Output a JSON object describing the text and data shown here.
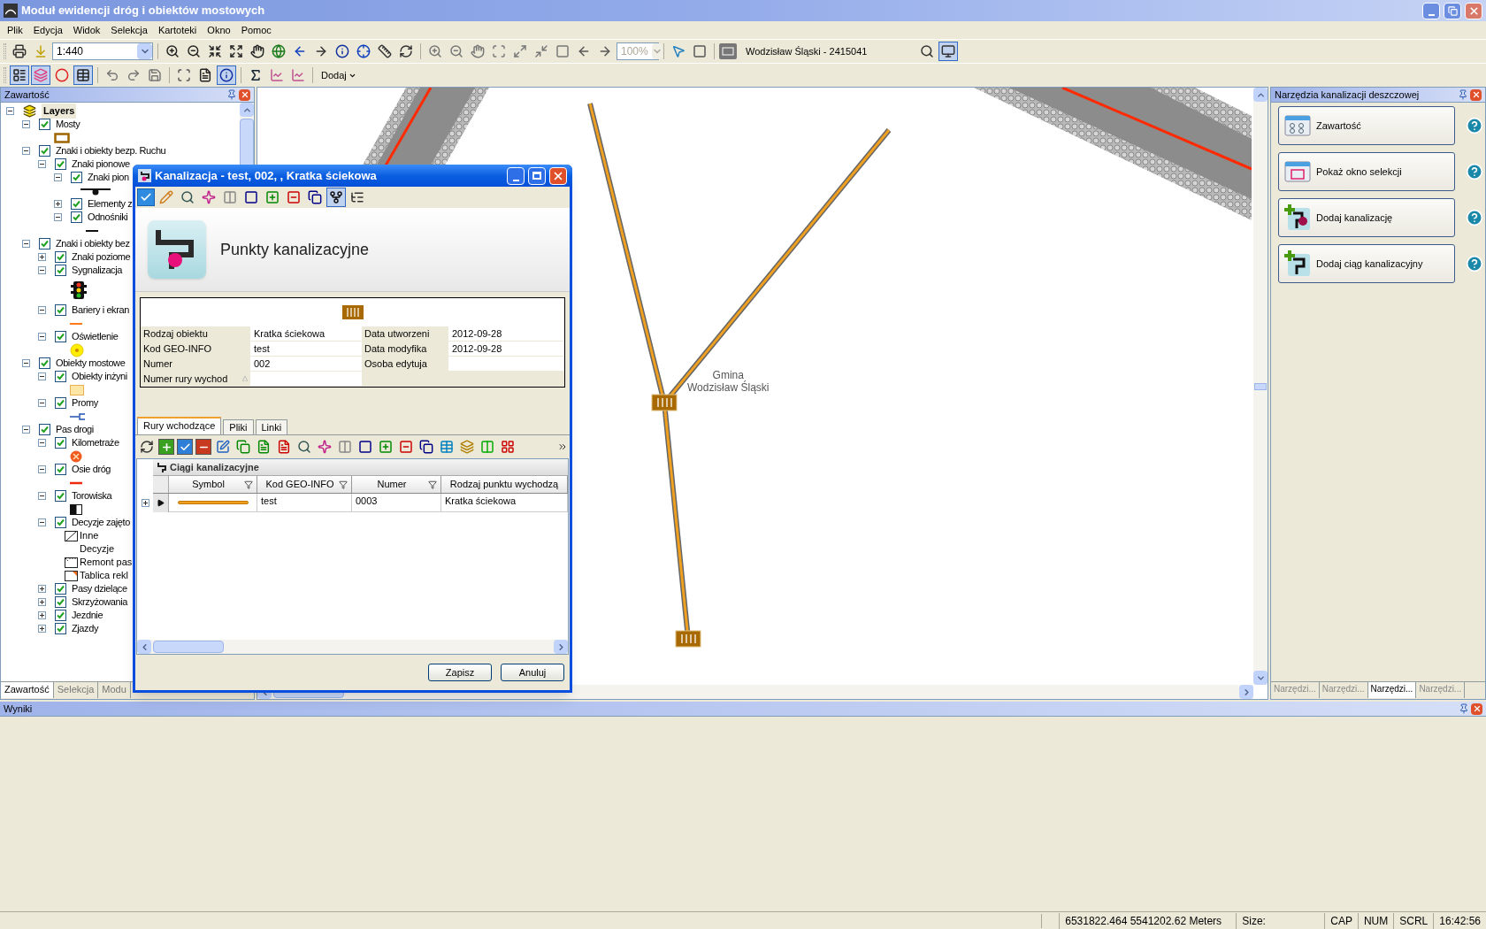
{
  "window": {
    "title": "Moduł ewidencji dróg i obiektów mostowych"
  },
  "menu": [
    "Plik",
    "Edycja",
    "Widok",
    "Selekcja",
    "Kartoteki",
    "Okno",
    "Pomoc"
  ],
  "toolbar": {
    "scale": "1:440",
    "zoom_percent": "100%",
    "location": "Wodzisław Śląski - 2415041",
    "add_button": "Dodaj"
  },
  "left_panel": {
    "title": "Zawartość",
    "tree": [
      {
        "label": "Layers",
        "kind": "root",
        "expanded": true,
        "children": [
          {
            "label": "Mosty",
            "kind": "layer",
            "checked": true,
            "expanded": true,
            "legend": {
              "kind": "frame"
            }
          },
          {
            "label": "Znaki i obiekty bezp. Ruchu",
            "kind": "layer",
            "checked": true,
            "expanded": true,
            "children": [
              {
                "label": "Znaki pionowe",
                "kind": "layer",
                "checked": true,
                "expanded": true,
                "children": [
                  {
                    "label": "Znaki pion",
                    "kind": "layer",
                    "checked": true,
                    "expanded": true,
                    "legend": {
                      "kind": "sign"
                    }
                  },
                  {
                    "label": "Elementy z",
                    "kind": "layer",
                    "checked": true,
                    "expanded": false
                  },
                  {
                    "label": "Odnośniki",
                    "kind": "layer",
                    "checked": true,
                    "expanded": true,
                    "legend": {
                      "kind": "dash"
                    }
                  }
                ]
              }
            ]
          },
          {
            "label": "Znaki i obiekty bez",
            "kind": "layer",
            "checked": true,
            "expanded": true,
            "children": [
              {
                "label": "Znaki poziome",
                "kind": "layer",
                "checked": true,
                "expanded": false
              },
              {
                "label": "Sygnalizacja",
                "kind": "layer",
                "checked": true,
                "expanded": true,
                "legend": {
                  "kind": "signal"
                }
              },
              {
                "label": "Bariery i ekran",
                "kind": "layer",
                "checked": true,
                "expanded": true,
                "legend": {
                  "kind": "barrier"
                }
              },
              {
                "label": "Oświetlenie",
                "kind": "layer",
                "checked": true,
                "expanded": true,
                "legend": {
                  "kind": "lamp"
                }
              }
            ]
          },
          {
            "label": "Obiekty mostowe",
            "kind": "layer",
            "checked": true,
            "expanded": true,
            "children": [
              {
                "label": "Obiekty inżyni",
                "kind": "layer",
                "checked": true,
                "expanded": true,
                "legend": {
                  "kind": "area"
                }
              },
              {
                "label": "Promy",
                "kind": "layer",
                "checked": true,
                "expanded": true,
                "legend": {
                  "kind": "ferry"
                }
              }
            ]
          },
          {
            "label": "Pas drogi",
            "kind": "layer",
            "checked": true,
            "expanded": true,
            "children": [
              {
                "label": "Kilometraże",
                "kind": "layer",
                "checked": true,
                "expanded": true,
                "legend": {
                  "kind": "milestone"
                }
              },
              {
                "label": "Osie dróg",
                "kind": "layer",
                "checked": true,
                "expanded": true,
                "legend": {
                  "kind": "axis"
                }
              },
              {
                "label": "Torowiska",
                "kind": "layer",
                "checked": true,
                "expanded": true,
                "legend": {
                  "kind": "track"
                }
              },
              {
                "label": "Decyzje zajęto",
                "kind": "layer",
                "checked": true,
                "expanded": true,
                "legend_items": [
                  {
                    "label": "Inne",
                    "kind": "hatch"
                  },
                  {
                    "label": "Decyzje",
                    "kind": "none"
                  },
                  {
                    "label": "Remont pas",
                    "kind": "corner"
                  },
                  {
                    "label": "Tablica rekl",
                    "kind": "flag"
                  }
                ]
              },
              {
                "label": "Pasy dzielące",
                "kind": "layer",
                "checked": true,
                "expanded": false
              },
              {
                "label": "Skrzyżowania",
                "kind": "layer",
                "checked": true,
                "expanded": false
              },
              {
                "label": "Jezdnie",
                "kind": "layer",
                "checked": true,
                "expanded": false
              },
              {
                "label": "Zjazdy",
                "kind": "layer",
                "checked": true,
                "expanded": false
              }
            ]
          }
        ]
      }
    ],
    "tabs": [
      {
        "label": "Zawartość",
        "selected": true
      },
      {
        "label": "Selekcja",
        "selected": false
      },
      {
        "label": "Modu",
        "selected": false
      }
    ]
  },
  "map": {
    "label_lines": [
      "Gmina",
      "Wodzisław Śląski"
    ]
  },
  "dialog": {
    "title": "Kanalizacja - test, 002, , Kratka ściekowa",
    "heading": "Punkty kanalizacyjne",
    "fields_left": [
      {
        "label": "Rodzaj obiektu",
        "value": "Kratka ściekowa"
      },
      {
        "label": "Kod GEO-INFO",
        "value": "test"
      },
      {
        "label": "Numer",
        "value": "002"
      },
      {
        "label": "Numer rury wychod"
      }
    ],
    "fields_right": [
      {
        "label": "Data utworzeni",
        "value": "2012-09-28"
      },
      {
        "label": "Data modyfika",
        "value": "2012-09-28"
      },
      {
        "label": "Osoba edytuja"
      }
    ],
    "tabs": [
      {
        "label": "Rury wchodzące",
        "selected": true
      },
      {
        "label": "Pliki",
        "selected": false
      },
      {
        "label": "Linki",
        "selected": false
      }
    ],
    "grid": {
      "title": "Ciągi kanalizacyjne",
      "columns": [
        "Symbol",
        "Kod GEO-INFO",
        "Numer",
        "Rodzaj punktu wychodzą"
      ],
      "rows": [
        {
          "expanded": false,
          "cells": [
            "",
            "test",
            "0003",
            "Kratka ściekowa"
          ]
        }
      ]
    },
    "buttons": [
      "Zapisz",
      "Anuluj"
    ]
  },
  "right_panel": {
    "title": "Narzędzia kanalizacji deszczowej",
    "buttons": [
      "Zawartość",
      "Pokaż okno selekcji",
      "Dodaj kanalizację",
      "Dodaj ciąg kanalizacyjny"
    ],
    "tabs": [
      {
        "label": "Narzędzi...",
        "selected": false
      },
      {
        "label": "Narzędzi...",
        "selected": false
      },
      {
        "label": "Narzędzi...",
        "selected": true
      },
      {
        "label": "Narzędzi...",
        "selected": false
      }
    ]
  },
  "results_panel": {
    "title": "Wyniki"
  },
  "status_bar": {
    "coordinates": "6531822.464 5541202.62 Meters",
    "size": "Size:",
    "indicators": [
      "CAP",
      "NUM",
      "SCRL"
    ],
    "time": "16:42:56"
  }
}
